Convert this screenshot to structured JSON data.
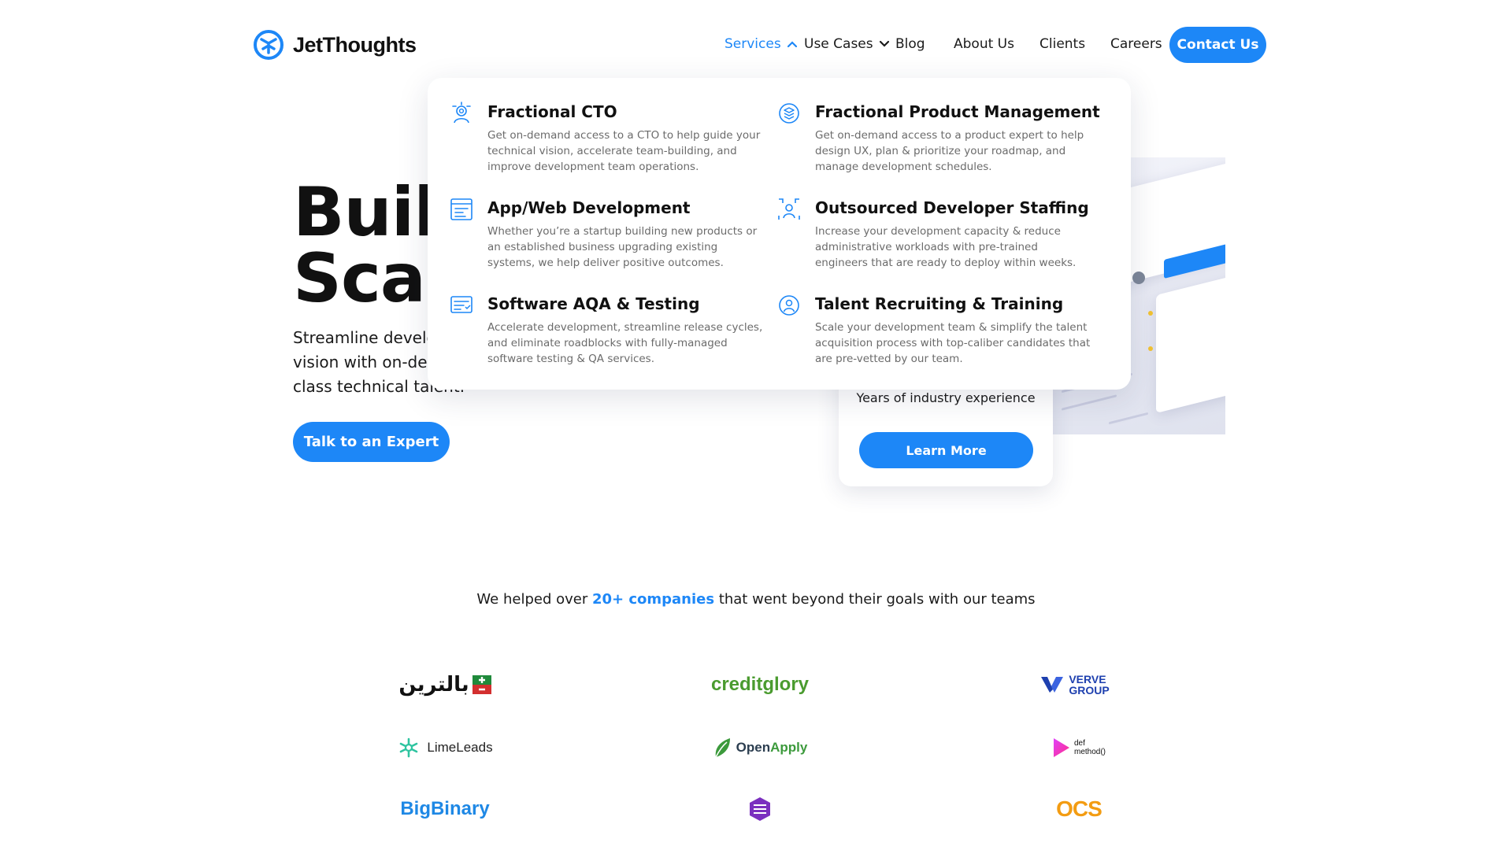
{
  "brand": {
    "name": "JetThoughts",
    "accent": "#1d87f7"
  },
  "nav": {
    "items": [
      {
        "label": "Services",
        "active": true,
        "has_menu": true
      },
      {
        "label": "Use Cases",
        "active": false,
        "has_menu": true
      },
      {
        "label": "Blog",
        "active": false,
        "has_menu": false
      },
      {
        "label": "About Us",
        "active": false,
        "has_menu": false
      },
      {
        "label": "Clients",
        "active": false,
        "has_menu": false
      },
      {
        "label": "Careers",
        "active": false,
        "has_menu": false
      }
    ],
    "contact_label": "Contact Us"
  },
  "hero": {
    "title_line1": "Build",
    "title_line2": "Scale",
    "subtitle": "Streamline development, accelerate your product vision with on-demand resources backed by world-class technical talent.",
    "cta_label": "Talk to an Expert"
  },
  "experience_card": {
    "text": "Years of industry experience",
    "button_label": "Learn More"
  },
  "services_menu": {
    "items": [
      {
        "title": "Fractional CTO",
        "icon": "cto-icon",
        "description": "Get on-demand access to a CTO to help guide your technical vision, accelerate team-building, and improve development team operations."
      },
      {
        "title": "Fractional Product Management",
        "icon": "product-management-icon",
        "description": "Get on-demand access to a product expert to help design UX, plan & prioritize your roadmap, and manage development schedules."
      },
      {
        "title": "App/Web Development",
        "icon": "app-web-dev-icon",
        "description": "Whether you’re a startup building new products or an established business upgrading existing systems, we help deliver positive outcomes."
      },
      {
        "title": "Outsourced Developer Staffing",
        "icon": "developer-staffing-icon",
        "description": "Increase your development capacity & reduce administrative workloads with pre-trained engineers that are ready to deploy within weeks."
      },
      {
        "title": "Software AQA & Testing",
        "icon": "testing-icon",
        "description": "Accelerate development, streamline release cycles, and eliminate roadblocks with fully-managed software testing & QA services."
      },
      {
        "title": "Talent Recruiting & Training",
        "icon": "recruiting-icon",
        "description": "Scale your development team & simplify the talent acquisition process with top-caliber candidates that are pre-vetted by our team."
      }
    ]
  },
  "clients": {
    "prefix": "We helped over ",
    "highlight": "20+ companies",
    "suffix": " that went beyond their goals with our teams",
    "logos": [
      {
        "name": "baltarin",
        "text": "بالترين"
      },
      {
        "name": "creditglory",
        "text": "creditglory"
      },
      {
        "name": "verve-group",
        "text_line1": "VERVE",
        "text_line2": "GROUP"
      },
      {
        "name": "limeleads",
        "text": "LimeLeads"
      },
      {
        "name": "openapply",
        "text": "OpenApply"
      },
      {
        "name": "def-method",
        "text_line1": "def",
        "text_line2": "method()"
      },
      {
        "name": "bigbinary",
        "text": "BigBinary"
      },
      {
        "name": "hexagon-brand",
        "text": ""
      },
      {
        "name": "ocs",
        "text": "OCS"
      }
    ]
  }
}
